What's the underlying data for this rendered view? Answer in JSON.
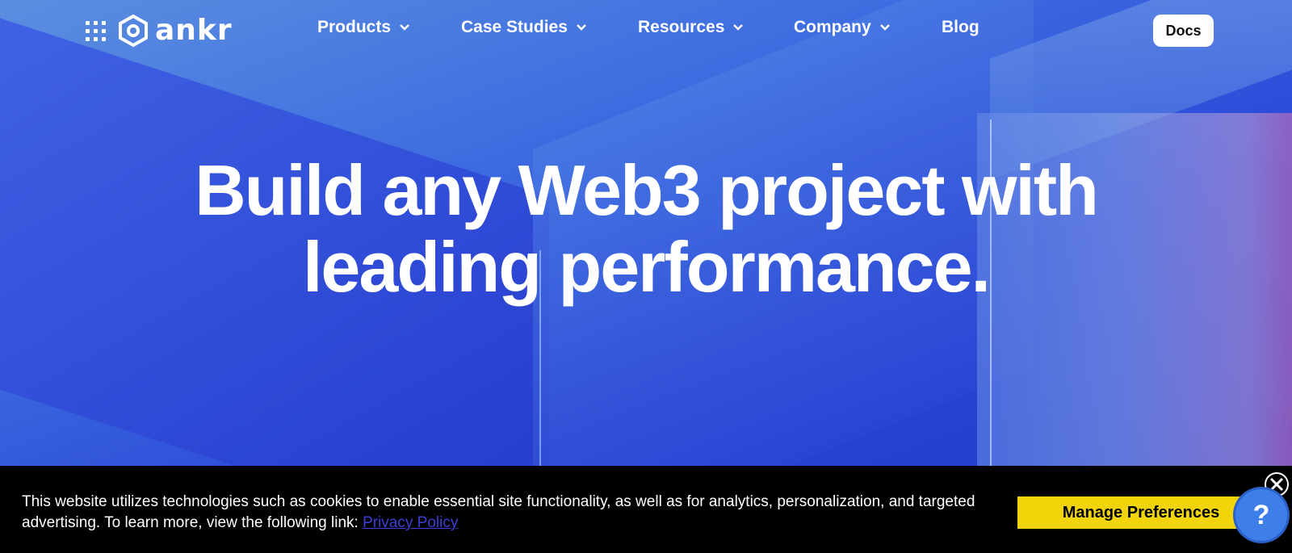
{
  "brand": {
    "name": "ankr"
  },
  "nav": {
    "items": [
      {
        "label": "Products",
        "has_dropdown": true
      },
      {
        "label": "Case Studies",
        "has_dropdown": true
      },
      {
        "label": "Resources",
        "has_dropdown": true
      },
      {
        "label": "Company",
        "has_dropdown": true
      },
      {
        "label": "Blog",
        "has_dropdown": false
      }
    ],
    "docs_label": "Docs"
  },
  "hero": {
    "headline_line1": "Build any Web3 project with",
    "headline_line2": "leading performance."
  },
  "cookie_banner": {
    "text_before_link": "This website utilizes technologies such as cookies to enable essential site functionality, as well as for analytics, personalization, and targeted advertising. To learn more, view the following link: ",
    "link_label": "Privacy Policy",
    "manage_button": "Manage Preferences",
    "close_icon": "close-icon"
  },
  "help_widget": {
    "label": "?"
  },
  "colors": {
    "hero_blue": "#2f4fd6",
    "banner_bg": "#000000",
    "manage_button_bg": "#f2d40a",
    "link_color": "#3b3fd6",
    "help_bubble": "#3e7ee8"
  }
}
